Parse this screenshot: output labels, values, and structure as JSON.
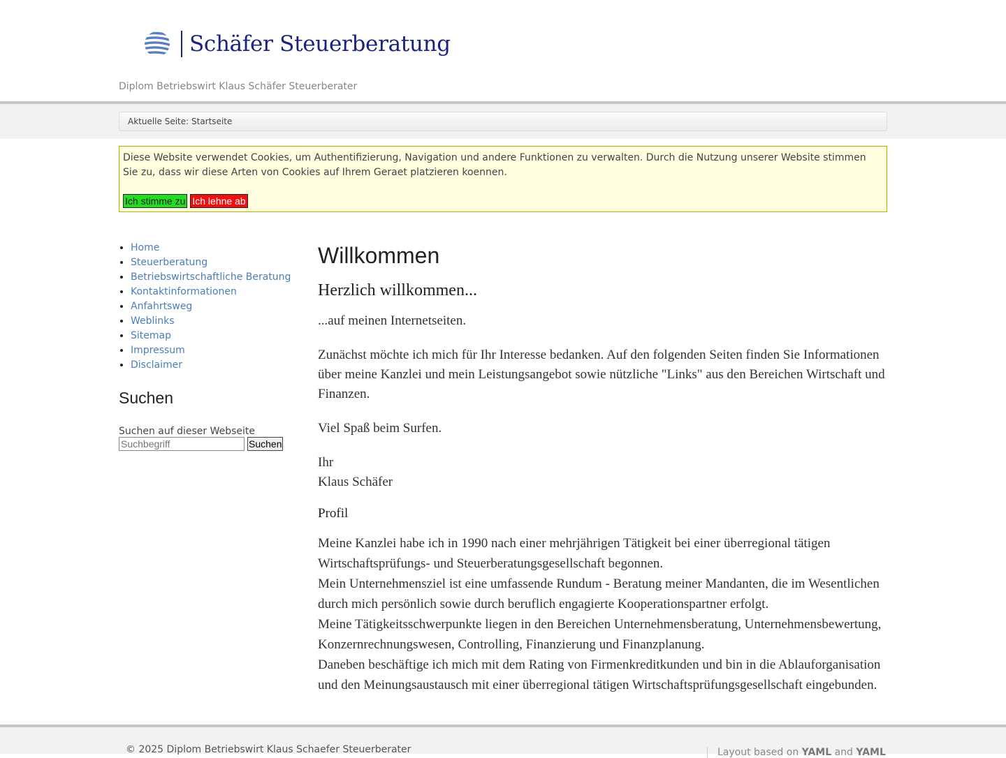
{
  "header": {
    "logo_text": "Schäfer Steuerberatung",
    "tagline": "Diplom Betriebswirt Klaus Schäfer Steuerberater"
  },
  "breadcrumb": {
    "text": "Aktuelle Seite: Startseite"
  },
  "cookie": {
    "message": "Diese Website verwendet Cookies, um Authentifizierung, Navigation und andere Funktionen zu verwalten. Durch die Nutzung unserer Website stimmen Sie zu, dass wir diese Arten von Cookies auf Ihrem Geraet platzieren koennen.",
    "accept": "Ich stimme zu",
    "decline": "Ich lehne ab",
    "accept_color": "#22dd22",
    "decline_color": "#ee1111"
  },
  "sidebar": {
    "items": [
      {
        "label": "Home"
      },
      {
        "label": "Steuerberatung"
      },
      {
        "label": "Betriebswirtschaftliche Beratung"
      },
      {
        "label": "Kontaktinformationen"
      },
      {
        "label": "Anfahrtsweg"
      },
      {
        "label": "Weblinks"
      },
      {
        "label": "Sitemap"
      },
      {
        "label": "Impressum"
      },
      {
        "label": "Disclaimer"
      }
    ],
    "search_title": "Suchen",
    "search_label": "Suchen auf dieser Webseite",
    "search_placeholder": "Suchbegriff",
    "search_button": "Suchen"
  },
  "main": {
    "title": "Willkommen",
    "subtitle": "Herzlich willkommen...",
    "intro": " ...auf meinen Internetseiten.",
    "para1": "Zunächst möchte ich mich für Ihr Interesse bedanken. Auf den folgenden Seiten finden Sie Informationen über meine Kanzlei und mein Leistungsangebot sowie nützliche \"Links\" aus den Bereichen Wirtschaft und Finanzen.",
    "para2": "Viel Spaß beim Surfen.",
    "sign1": "Ihr",
    "sign2": "Klaus Schäfer",
    "profile_title": "Profil",
    "profile": [
      "Meine Kanzlei habe ich in 1990 nach einer mehrjährigen Tätigkeit bei einer überregional tätigen Wirtschaftsprüfungs- und Steuerberatungsgesellschaft begonnen.",
      "Mein Unternehmensziel ist eine umfassende Rundum - Beratung meiner Mandanten, die im Wesentlichen durch mich persönlich sowie durch beruflich engagierte Kooperationspartner erfolgt.",
      "Meine Tätigkeitsschwerpunkte liegen in den Bereichen Unternehmensberatung, Unternehmensbewertung, Konzernrechnungswesen, Controlling, Finanzierung und Finanzplanung.",
      "Daneben beschäftige ich mich mit dem Rating von Firmenkreditkunden und bin in die Ablauforganisation und den Meinungsaustausch mit einer überregional tätigen Wirtschaftsprüfungsgesellschaft eingebunden."
    ]
  },
  "footer": {
    "copyright": "© 2025 Diplom Betriebswirt Klaus Schaefer Steuerberater",
    "layout_prefix": "Layout based on ",
    "layout_link1": "YAML",
    "layout_and": " and ",
    "layout_link2": "YAML"
  }
}
